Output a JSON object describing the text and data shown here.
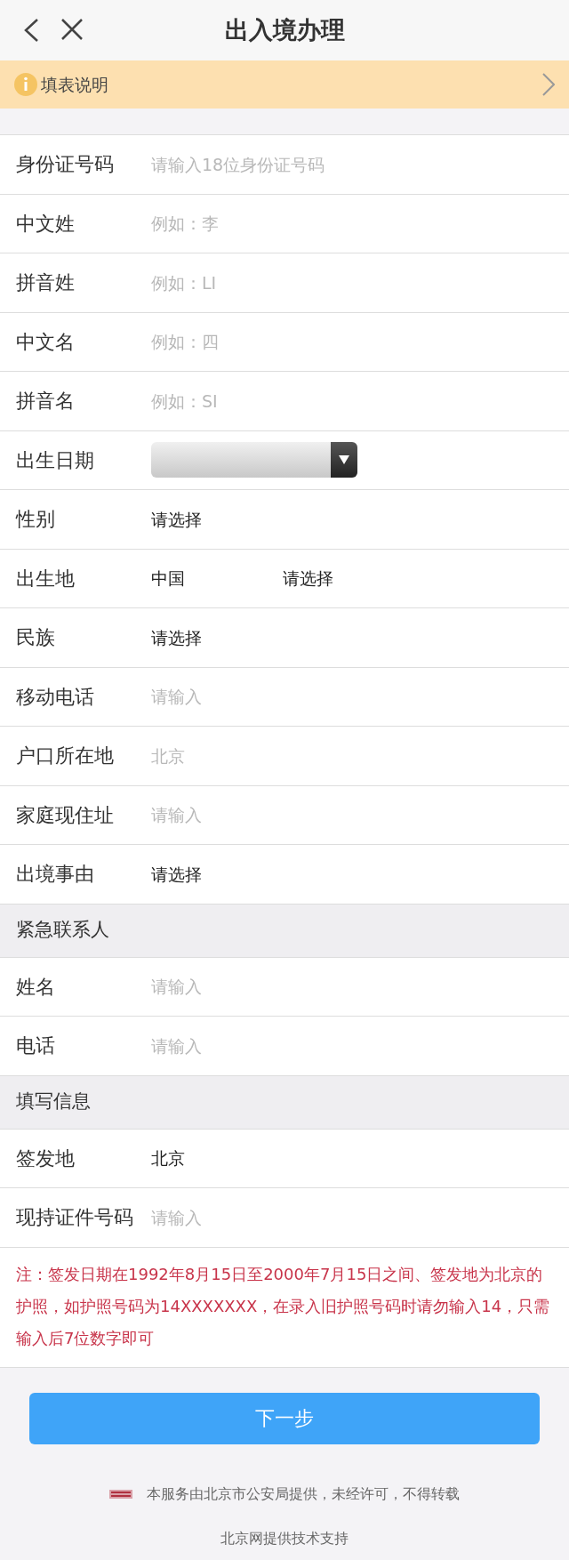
{
  "header": {
    "title": "出入境办理"
  },
  "notice": {
    "text": "填表说明"
  },
  "sections": [
    {
      "fields": [
        {
          "kind": "input",
          "label": "身份证号码",
          "placeholder": "请输入18位身份证号码"
        },
        {
          "kind": "input",
          "label": "中文姓",
          "placeholder": "例如：李"
        },
        {
          "kind": "input",
          "label": "拼音姓",
          "placeholder": "例如：LI"
        },
        {
          "kind": "input",
          "label": "中文名",
          "placeholder": "例如：四"
        },
        {
          "kind": "input",
          "label": "拼音名",
          "placeholder": "例如：SI"
        },
        {
          "kind": "date",
          "label": "出生日期"
        },
        {
          "kind": "select",
          "label": "性别",
          "values": [
            "请选择"
          ]
        },
        {
          "kind": "select",
          "label": "出生地",
          "values": [
            "中国",
            "请选择"
          ]
        },
        {
          "kind": "select",
          "label": "民族",
          "values": [
            "请选择"
          ]
        },
        {
          "kind": "input",
          "label": "移动电话",
          "placeholder": "请输入"
        },
        {
          "kind": "input",
          "label": "户口所在地",
          "placeholder": "北京"
        },
        {
          "kind": "input",
          "label": "家庭现住址",
          "placeholder": "请输入"
        },
        {
          "kind": "select",
          "label": "出境事由",
          "values": [
            "请选择"
          ]
        }
      ]
    },
    {
      "title": "紧急联系人",
      "fields": [
        {
          "kind": "input",
          "label": "姓名",
          "placeholder": "请输入"
        },
        {
          "kind": "input",
          "label": "电话",
          "placeholder": "请输入"
        }
      ]
    },
    {
      "title": "填写信息",
      "fields": [
        {
          "kind": "select",
          "label": "签发地",
          "values": [
            "北京"
          ]
        },
        {
          "kind": "input",
          "label": "现持证件号码",
          "placeholder": "请输入"
        }
      ]
    }
  ],
  "note": "注：签发日期在1992年8月15日至2000年7月15日之间、签发地为北京的护照，如护照号码为14XXXXXXX，在录入旧护照号码时请勿输入14，只需输入后7位数字即可",
  "next_button": "下一步",
  "footer": {
    "copyright": "本服务由北京市公安局提供，未经许可，不得转载",
    "tech_support": "北京网提供技术支持"
  }
}
